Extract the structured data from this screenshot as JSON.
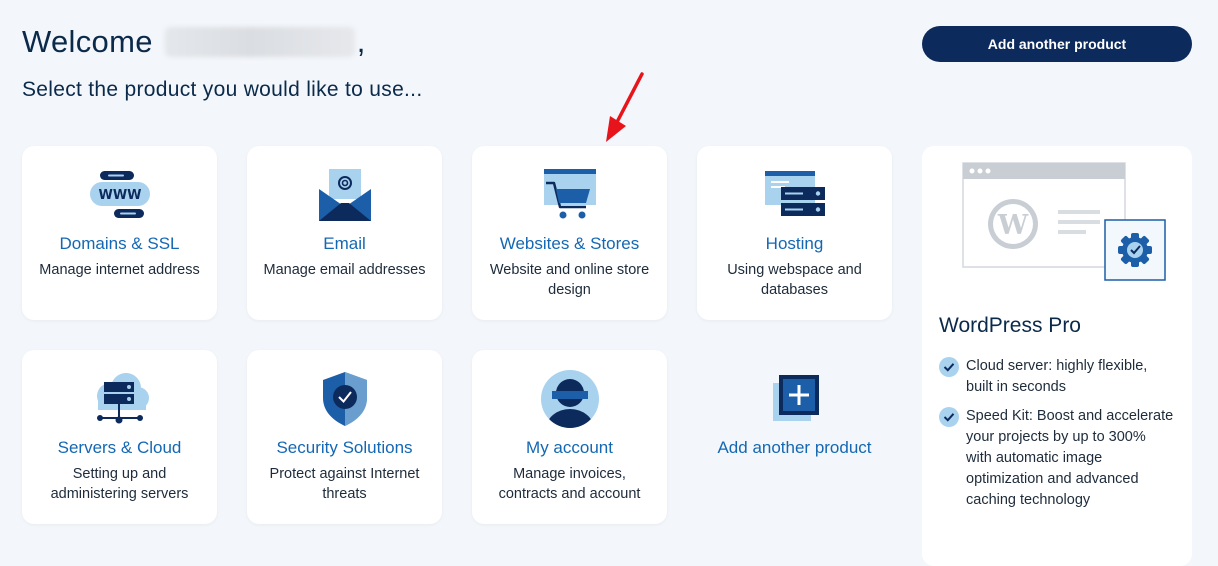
{
  "header": {
    "welcome": "Welcome",
    "welcome_suffix": ",",
    "subtitle": "Select the product you would like to use...",
    "add_product_button": "Add another product"
  },
  "products": [
    {
      "title": "Domains & SSL",
      "desc": "Manage internet address",
      "icon": "www-icon"
    },
    {
      "title": "Email",
      "desc": "Manage email addresses",
      "icon": "email-icon"
    },
    {
      "title": "Websites & Stores",
      "desc": "Website and online store design",
      "icon": "store-icon"
    },
    {
      "title": "Hosting",
      "desc": "Using webspace and databases",
      "icon": "hosting-icon"
    },
    {
      "title": "Servers & Cloud",
      "desc": "Setting up and administering servers",
      "icon": "cloud-server-icon"
    },
    {
      "title": "Security Solutions",
      "desc": "Protect against Internet threats",
      "icon": "shield-icon"
    },
    {
      "title": "My account",
      "desc": "Manage invoices, contracts and account",
      "icon": "user-icon"
    },
    {
      "title": "Add another product",
      "icon": "plus-icon"
    }
  ],
  "promo": {
    "title": "WordPress Pro",
    "features": [
      "Cloud server: highly flexible, built in seconds",
      "Speed Kit: Boost and accelerate your projects by up to 300% with automatic image optimization and advanced caching technology"
    ]
  },
  "colors": {
    "background": "#f3f6fa",
    "accent": "#1468b3",
    "navy": "#0d2a5c",
    "light_blue": "#a9d2ef",
    "arrow": "#e8141b"
  }
}
